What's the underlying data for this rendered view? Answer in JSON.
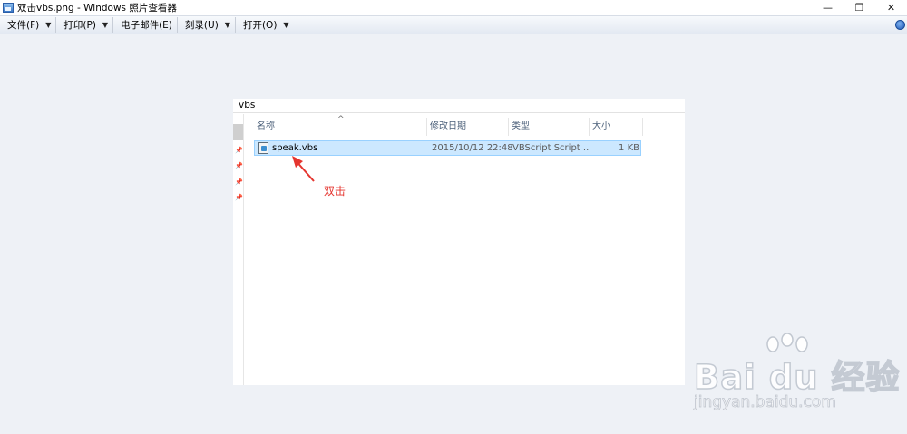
{
  "window": {
    "title": "双击vbs.png - Windows 照片查看器",
    "minimize_glyph": "—",
    "restore_glyph": "❐",
    "close_glyph": "✕"
  },
  "menu": {
    "items": [
      {
        "label": "文件(F)",
        "has_arrow": true
      },
      {
        "label": "打印(P)",
        "has_arrow": true
      },
      {
        "label": "电子邮件(E)",
        "has_arrow": false
      },
      {
        "label": "刻录(U)",
        "has_arrow": true
      },
      {
        "label": "打开(O)",
        "has_arrow": true
      }
    ],
    "arrow_glyph": "▼"
  },
  "picture": {
    "folder_title": "vbs",
    "columns": [
      "名称",
      "修改日期",
      "类型",
      "大小"
    ],
    "file": {
      "name": "speak.vbs",
      "modified": "2015/10/12 22:48",
      "type": "VBScript Script ...",
      "size": "1 KB"
    },
    "annotation": "双击",
    "annotation_color": "#e5352f",
    "selection_color": "#cce8ff"
  },
  "watermark": {
    "logo": "Bai du 经验",
    "url": "jingyan.baidu.com"
  }
}
